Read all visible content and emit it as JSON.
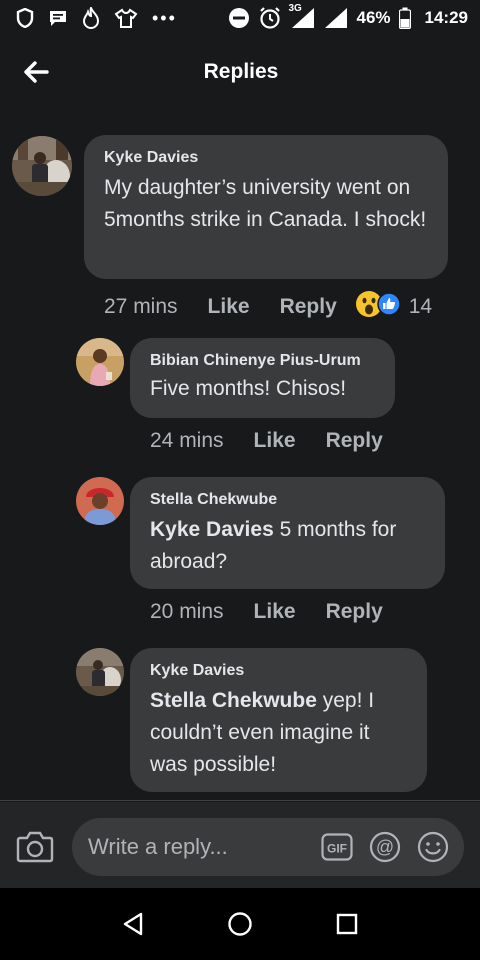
{
  "status_bar": {
    "network": "3G",
    "battery": "46%",
    "time": "14:29"
  },
  "header": {
    "title": "Replies"
  },
  "comments": [
    {
      "author": "Kyke Davies",
      "text": "My daughter’s university went on 5months strike in Canada. I shock!",
      "time": "27 mins",
      "like": "Like",
      "reply": "Reply",
      "reaction_count": "14"
    },
    {
      "author": "Bibian Chinenye Pius-Urum",
      "text": "Five months! Chisos!",
      "time": "24 mins",
      "like": "Like",
      "reply": "Reply"
    },
    {
      "author": "Stella Chekwube",
      "mention": "Kyke Davies",
      "text": " 5 months for abroad?",
      "time": "20 mins",
      "like": "Like",
      "reply": "Reply"
    },
    {
      "author": "Kyke Davies",
      "mention": "Stella Chekwube",
      "text": " yep! I couldn’t even imagine it was possible!"
    }
  ],
  "reply_bar": {
    "placeholder": "Write a reply..."
  },
  "icons": [
    "back-arrow-icon",
    "camera-icon",
    "gif-icon",
    "at-icon",
    "emoji-icon",
    "wow-reaction-icon",
    "like-reaction-icon",
    "back-nav-icon",
    "home-nav-icon",
    "recents-nav-icon"
  ]
}
